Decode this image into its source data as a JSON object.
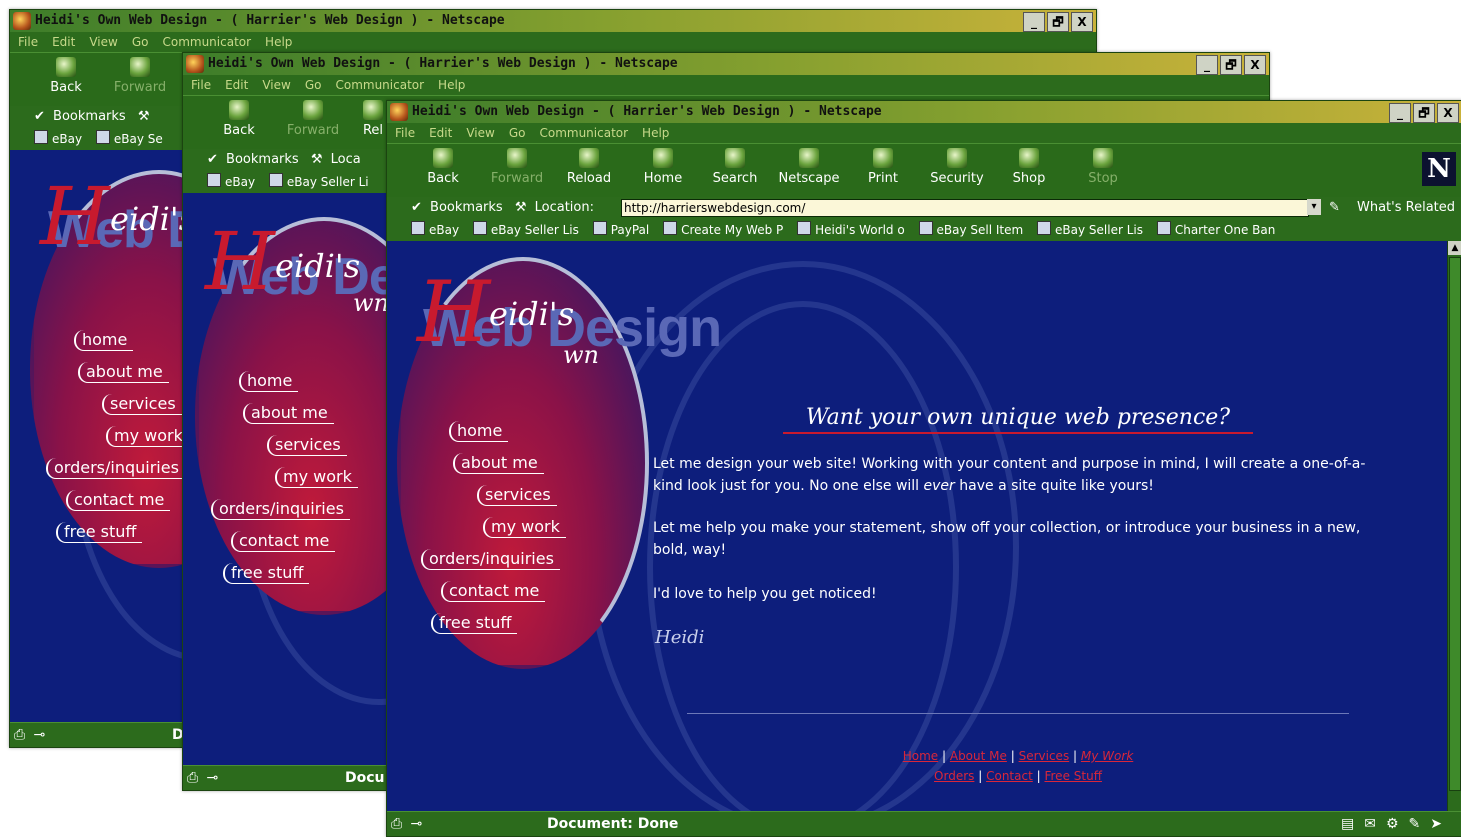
{
  "window": {
    "title": "Heidi's Own Web Design - ( Harrier's Web Design ) - Netscape",
    "controls": [
      "_",
      "🗗",
      "X"
    ]
  },
  "menu": [
    "File",
    "Edit",
    "View",
    "Go",
    "Communicator",
    "Help"
  ],
  "toolbar": [
    "Back",
    "Forward",
    "Reload",
    "Home",
    "Search",
    "Netscape",
    "Print",
    "Security",
    "Shop",
    "Stop"
  ],
  "win2_toolbar_partial": "Rel",
  "location": {
    "bookmarks_label": "Bookmarks",
    "location_label": "Location:",
    "url": "http://harrierswebdesign.com/",
    "related_label": "What's Related",
    "win2_loc_partial": "Loca"
  },
  "personal_bar": [
    "eBay",
    "eBay Seller Lis",
    "PayPal",
    "Create My Web P",
    "Heidi's World o",
    "eBay Sell Item",
    "eBay Seller Lis",
    "Charter One Ban"
  ],
  "personal_bar_partial": {
    "win1": "eBay Se",
    "win2": "eBay Seller Li"
  },
  "logo": {
    "initial": "H",
    "rest": "eidi's",
    "own": "wn",
    "backdrop": "Web Design",
    "backdrop_win1": "Web D",
    "backdrop_win2": "Web Des"
  },
  "nav": [
    "home",
    "about me",
    "services",
    "my work",
    "orders/inquiries",
    "contact me",
    "free stuff"
  ],
  "main": {
    "heading": "Want your own unique web presence?",
    "para1_a": "Let me design your web site!  Working with your content and purpose in mind, I will create a one-of-a-kind look just for you.  No one else will ",
    "para1_em": "ever",
    "para1_b": " have a site quite like yours!",
    "para2": "Let me help you make your statement, show off your collection, or introduce your business in a new, bold, way!",
    "para3": "I'd love to help you get noticed!",
    "signature": "Heidi"
  },
  "footer_links": {
    "row1": [
      "Home",
      "About Me",
      "Services",
      "My Work"
    ],
    "row2": [
      "Orders",
      "Contact",
      "Free Stuff"
    ],
    "sep": "|"
  },
  "status": {
    "text": "Document: Done",
    "win1_partial": "D",
    "win2_partial": "Docu"
  },
  "colors": {
    "chrome": "#2c6b1c",
    "page_bg": "#0d1e7c",
    "accent_red": "#c81a2e",
    "link_red": "#d8273a"
  }
}
